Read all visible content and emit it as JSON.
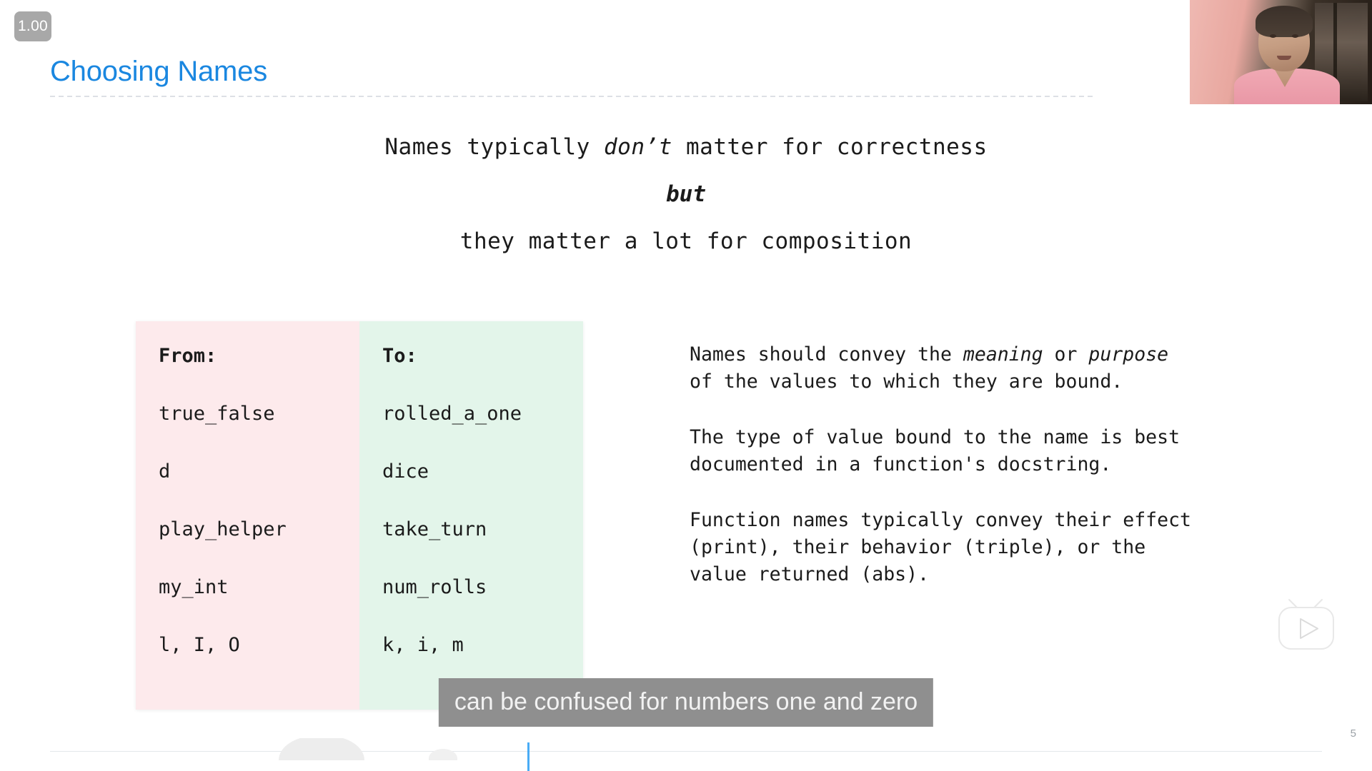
{
  "player": {
    "speed_badge": "1.00",
    "caption_text": "can be confused for numbers one and zero",
    "play_icon": "tv-play-icon",
    "webcam_label": "presenter-webcam"
  },
  "slide": {
    "title": "Choosing Names",
    "number": "5",
    "intro": {
      "line1_before": "Names typically ",
      "line1_italic": "don’t",
      "line1_after": " matter for correctness",
      "line2": "but",
      "line3": "they matter a lot for composition"
    },
    "table": {
      "from_header": "From:",
      "to_header": "To:",
      "rows": [
        {
          "from": "true_false",
          "to": "rolled_a_one"
        },
        {
          "from": "d",
          "to": "dice"
        },
        {
          "from": "play_helper",
          "to": "take_turn"
        },
        {
          "from": "my_int",
          "to": "num_rolls"
        },
        {
          "from": "l, I, O",
          "to": "k, i, m"
        }
      ]
    },
    "notes": [
      {
        "seg1": "Names should convey the ",
        "em1": "meaning",
        "seg2": " or ",
        "em2": "purpose",
        "seg3": "\nof the values to which they are bound."
      },
      {
        "text": "The type of value bound to the name is best\ndocumented in a function's docstring."
      },
      {
        "text": "Function names typically convey their effect\n(print), their behavior (triple), or the\nvalue returned (abs)."
      }
    ]
  },
  "colors": {
    "title_blue": "#1a87e0",
    "from_bg": "#fdeaec",
    "to_bg": "#e3f5ea",
    "caption_bg": "#8f8f8f",
    "badge_bg": "#a8a8a8",
    "playhead": "#2a9df4"
  }
}
